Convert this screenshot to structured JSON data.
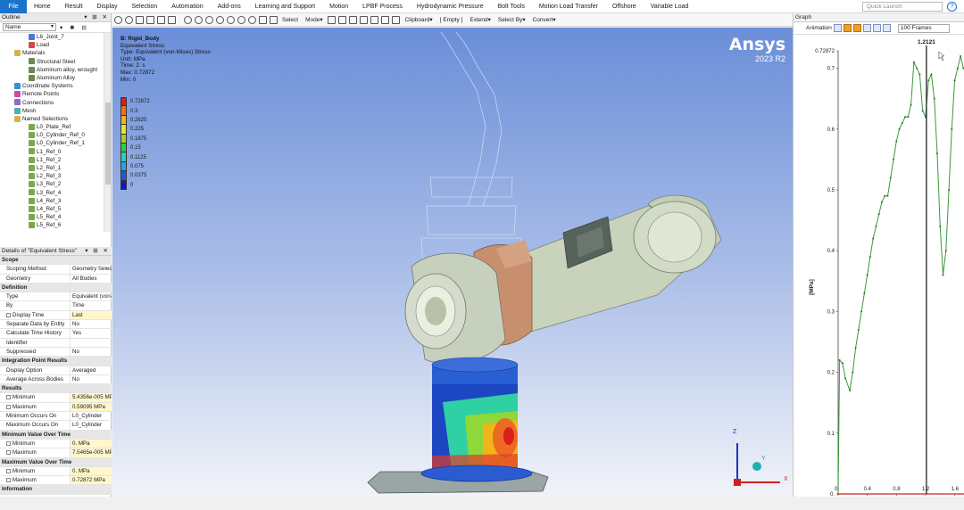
{
  "menubar": {
    "file": "File",
    "items": [
      "Home",
      "Result",
      "Display",
      "Selection",
      "Automation",
      "Add-ons",
      "Learning and Support",
      "Motion",
      "LPBF Process",
      "Hydrodynamic Pressure",
      "Bolt Tools",
      "Motion Load Transfer",
      "Offshore",
      "Variable Load"
    ],
    "quick_launch": "Quick Launch"
  },
  "outline": {
    "title": "Outline",
    "filter_value": "Name",
    "items": [
      {
        "label": "L6_Joint_7",
        "indent": 4,
        "icon": "joint-icon"
      },
      {
        "label": "Load",
        "indent": 4,
        "icon": "load-icon"
      },
      {
        "label": "Materials",
        "indent": 2,
        "icon": "folder-icon"
      },
      {
        "label": "Structural Steel",
        "indent": 4,
        "icon": "material-icon"
      },
      {
        "label": "Aluminum alloy, wrought",
        "indent": 4,
        "icon": "material-icon"
      },
      {
        "label": "Aluminum Alloy",
        "indent": 4,
        "icon": "material-icon"
      },
      {
        "label": "Coordinate Systems",
        "indent": 2,
        "icon": "coordinate-icon"
      },
      {
        "label": "Remote Points",
        "indent": 2,
        "icon": "remote-point-icon"
      },
      {
        "label": "Connections",
        "indent": 2,
        "icon": "connections-icon"
      },
      {
        "label": "Mesh",
        "indent": 2,
        "icon": "mesh-icon"
      },
      {
        "label": "Named Selections",
        "indent": 2,
        "icon": "folder-icon"
      },
      {
        "label": "L0_Plate_Ref",
        "indent": 4,
        "icon": "named-selection-icon"
      },
      {
        "label": "L0_Cylinder_Ref_0",
        "indent": 4,
        "icon": "named-selection-icon"
      },
      {
        "label": "L0_Cylinder_Ref_1",
        "indent": 4,
        "icon": "named-selection-icon"
      },
      {
        "label": "L1_Ref_0",
        "indent": 4,
        "icon": "named-selection-icon"
      },
      {
        "label": "L1_Ref_2",
        "indent": 4,
        "icon": "named-selection-icon"
      },
      {
        "label": "L2_Ref_1",
        "indent": 4,
        "icon": "named-selection-icon"
      },
      {
        "label": "L2_Ref_3",
        "indent": 4,
        "icon": "named-selection-icon"
      },
      {
        "label": "L3_Ref_2",
        "indent": 4,
        "icon": "named-selection-icon"
      },
      {
        "label": "L3_Ref_4",
        "indent": 4,
        "icon": "named-selection-icon"
      },
      {
        "label": "L4_Ref_3",
        "indent": 4,
        "icon": "named-selection-icon"
      },
      {
        "label": "L4_Ref_5",
        "indent": 4,
        "icon": "named-selection-icon"
      },
      {
        "label": "L5_Ref_4",
        "indent": 4,
        "icon": "named-selection-icon"
      },
      {
        "label": "L5_Ref_6",
        "indent": 4,
        "icon": "named-selection-icon"
      }
    ]
  },
  "details": {
    "title": "Details of \"Equivalent Stress\"",
    "rows": [
      {
        "type": "sec",
        "k": "Scope"
      },
      {
        "k": "Scoping Method",
        "v": "Geometry Selection"
      },
      {
        "k": "Geometry",
        "v": "All Bodies"
      },
      {
        "type": "sec",
        "k": "Definition"
      },
      {
        "k": "Type",
        "v": "Equivalent (von-Mises) Stress"
      },
      {
        "k": "By",
        "v": "Time"
      },
      {
        "k": "Display Time",
        "v": "Last",
        "cb": true
      },
      {
        "k": "Separate Data by Entity",
        "v": "No"
      },
      {
        "k": "Calculate Time History",
        "v": "Yes"
      },
      {
        "k": "Identifier",
        "v": ""
      },
      {
        "k": "Suppressed",
        "v": "No"
      },
      {
        "type": "sec",
        "k": "Integration Point Results"
      },
      {
        "k": "Display Option",
        "v": "Averaged"
      },
      {
        "k": "Average Across Bodies",
        "v": "No"
      },
      {
        "type": "sec",
        "k": "Results"
      },
      {
        "k": "Minimum",
        "v": "5.4356e-005 MPa",
        "cb": true
      },
      {
        "k": "Maximum",
        "v": "0.59095 MPa",
        "cb": true
      },
      {
        "k": "Minimum Occurs On",
        "v": "L0_Cylinder"
      },
      {
        "k": "Maximum Occurs On",
        "v": "L0_Cylinder"
      },
      {
        "type": "sec",
        "k": "Minimum Value Over Time"
      },
      {
        "k": "Minimum",
        "v": "0. MPa",
        "cb": true
      },
      {
        "k": "Maximum",
        "v": "7.5465e-005 MPa",
        "cb": true
      },
      {
        "type": "sec",
        "k": "Maximum Value Over Time"
      },
      {
        "k": "Minimum",
        "v": "0. MPa",
        "cb": true
      },
      {
        "k": "Maximum",
        "v": "0.72872 MPa",
        "cb": true
      },
      {
        "type": "sec",
        "k": "Information"
      }
    ]
  },
  "toolbar": {
    "select": "Select",
    "mode": "Mode▾",
    "clipboard": "Clipboard▾",
    "empty": "[ Empty ]",
    "extend": "Extend▾",
    "select_by": "Select By▾",
    "convert": "Convert▾"
  },
  "viewport": {
    "title": "B: Rigid_Body",
    "lines": [
      "Equivalent Stress",
      "Type: Equivalent (von-Mises) Stress",
      "Unit: MPa",
      "Time: 2. s",
      "Max: 0.72872",
      "Min: 0"
    ],
    "legend": [
      {
        "label": "0.72872",
        "color": "#d41f1f"
      },
      {
        "label": "0.3",
        "color": "#f07020"
      },
      {
        "label": "0.2625",
        "color": "#f3b61d"
      },
      {
        "label": "0.225",
        "color": "#e8e820"
      },
      {
        "label": "0.1875",
        "color": "#9ad82a"
      },
      {
        "label": "0.15",
        "color": "#30d040"
      },
      {
        "label": "0.1125",
        "color": "#28d3b0"
      },
      {
        "label": "0.075",
        "color": "#22a8e0"
      },
      {
        "label": "0.0375",
        "color": "#1d5ae0"
      },
      {
        "label": "0",
        "color": "#1616c8"
      }
    ],
    "logo": "Ansys",
    "version": "2023 R2",
    "triad_z": "Z",
    "triad_x": "X",
    "triad_y": "Y"
  },
  "graph": {
    "title": "Graph",
    "animation_label": "Animation",
    "frames": "100 Frames",
    "cursor_value": "1.2121",
    "y_axis_label": "[MPa]"
  },
  "chart_data": {
    "type": "line",
    "title": "",
    "xlabel": "",
    "ylabel": "[MPa]",
    "ylim": [
      0,
      0.72872
    ],
    "xlim": [
      0,
      1.74
    ],
    "y_ticks": [
      "0.72872",
      "0.7",
      "0.6",
      "0.5",
      "0.4",
      "0.3",
      "0.2",
      "0.1",
      "0."
    ],
    "x_ticks": [
      "0.",
      "0.4",
      "0.8",
      "1.2",
      "1.6"
    ],
    "series": [
      {
        "name": "",
        "color": "#3a9a3a",
        "x": [
          0.0,
          0.02,
          0.06,
          0.1,
          0.16,
          0.2,
          0.24,
          0.28,
          0.32,
          0.36,
          0.4,
          0.44,
          0.48,
          0.52,
          0.56,
          0.6,
          0.64,
          0.68,
          0.72,
          0.76,
          0.8,
          0.84,
          0.88,
          0.92,
          0.96,
          1.0,
          1.04,
          1.08,
          1.12,
          1.16,
          1.2,
          1.24,
          1.28,
          1.32,
          1.36,
          1.4,
          1.44,
          1.48,
          1.52,
          1.56,
          1.6,
          1.64,
          1.68,
          1.72
        ],
        "y": [
          0.0,
          0.22,
          0.215,
          0.19,
          0.17,
          0.2,
          0.24,
          0.27,
          0.3,
          0.33,
          0.36,
          0.39,
          0.42,
          0.44,
          0.46,
          0.48,
          0.49,
          0.49,
          0.52,
          0.55,
          0.58,
          0.6,
          0.61,
          0.62,
          0.62,
          0.64,
          0.71,
          0.7,
          0.69,
          0.63,
          0.62,
          0.68,
          0.69,
          0.65,
          0.56,
          0.44,
          0.36,
          0.4,
          0.5,
          0.6,
          0.68,
          0.7,
          0.72,
          0.7
        ]
      },
      {
        "name": "",
        "color": "#cc2222",
        "x": [
          0.0,
          1.74
        ],
        "y": [
          0.0,
          0.0
        ]
      }
    ],
    "cursor_x": 1.2121,
    "grid": false,
    "legend": "none"
  }
}
